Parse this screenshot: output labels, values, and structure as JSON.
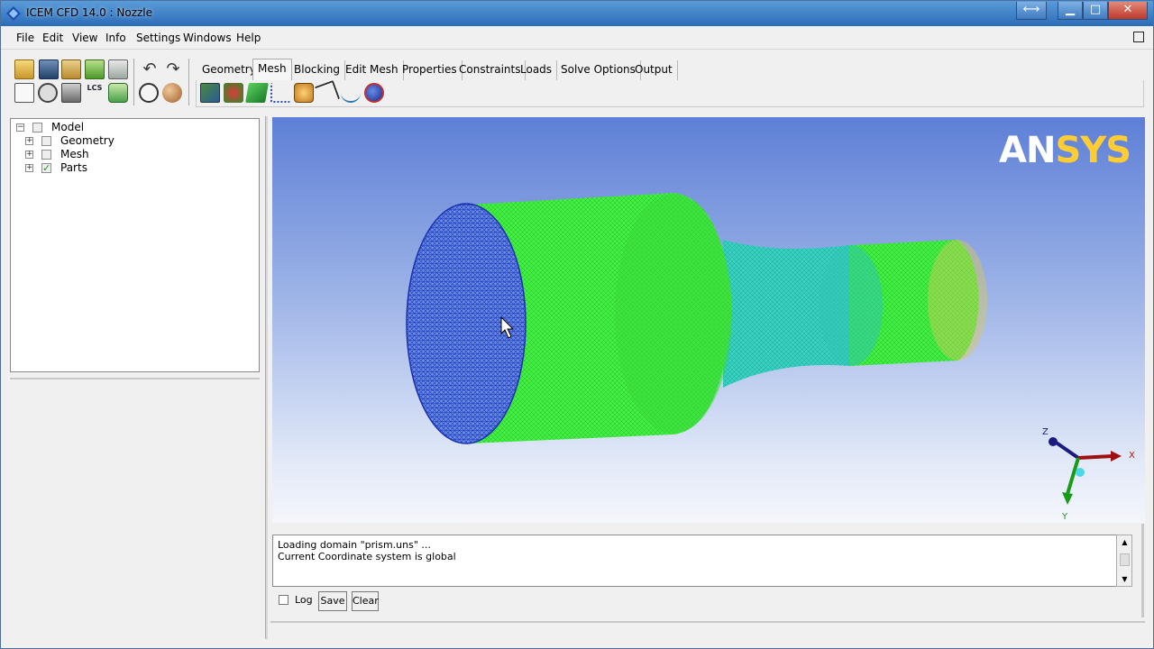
{
  "window": {
    "title": "ICEM CFD 14.0 : Nozzle",
    "controls": {
      "resize": "⟷",
      "minimize": "▁",
      "maximize": "□",
      "close": "✕"
    }
  },
  "menu": [
    "File",
    "Edit",
    "View",
    "Info",
    "Settings",
    "Windows",
    "Help"
  ],
  "toolbar": {
    "row1_icons": [
      "open-icon",
      "save-icon",
      "import-geometry-icon",
      "import-mesh-icon",
      "export-icon",
      "undo-icon",
      "redo-icon"
    ],
    "row2_icons": [
      "fit-window-icon",
      "zoom-box-icon",
      "measure-icon",
      "local-coordinate-icon",
      "refresh-icon",
      "wireframe-icon",
      "solid-icon"
    ]
  },
  "tabs": [
    "Geometry",
    "Mesh",
    "Blocking",
    "Edit Mesh",
    "Properties",
    "Constraints",
    "Loads",
    "Solve Options",
    "Output"
  ],
  "active_tab": "Mesh",
  "mesh_tools": [
    "global-mesh-setup-icon",
    "part-mesh-setup-icon",
    "surface-mesh-setup-icon",
    "curve-mesh-setup-icon",
    "create-mesh-density-icon",
    "define-connectors-icon",
    "mesh-curve-icon",
    "compute-mesh-icon"
  ],
  "tree": {
    "root": "Model",
    "children": [
      "Geometry",
      "Mesh",
      "Parts"
    ]
  },
  "viewport": {
    "logo_prefix": "AN",
    "logo_suffix": "SYS",
    "axis_labels": {
      "x": "X",
      "y": "Y",
      "z": "Z"
    }
  },
  "messages": [
    "Loading domain \"prism.uns\" ...",
    "Current Coordinate system is global"
  ],
  "message_controls": {
    "log_label": "Log",
    "save_label": "Save",
    "clear_label": "Clear"
  },
  "colors": {
    "mesh_green": "#33ee33",
    "mesh_blue": "#2a4fd8",
    "mesh_teal": "#2cc8b8",
    "logo_yellow": "#ffcc33"
  }
}
